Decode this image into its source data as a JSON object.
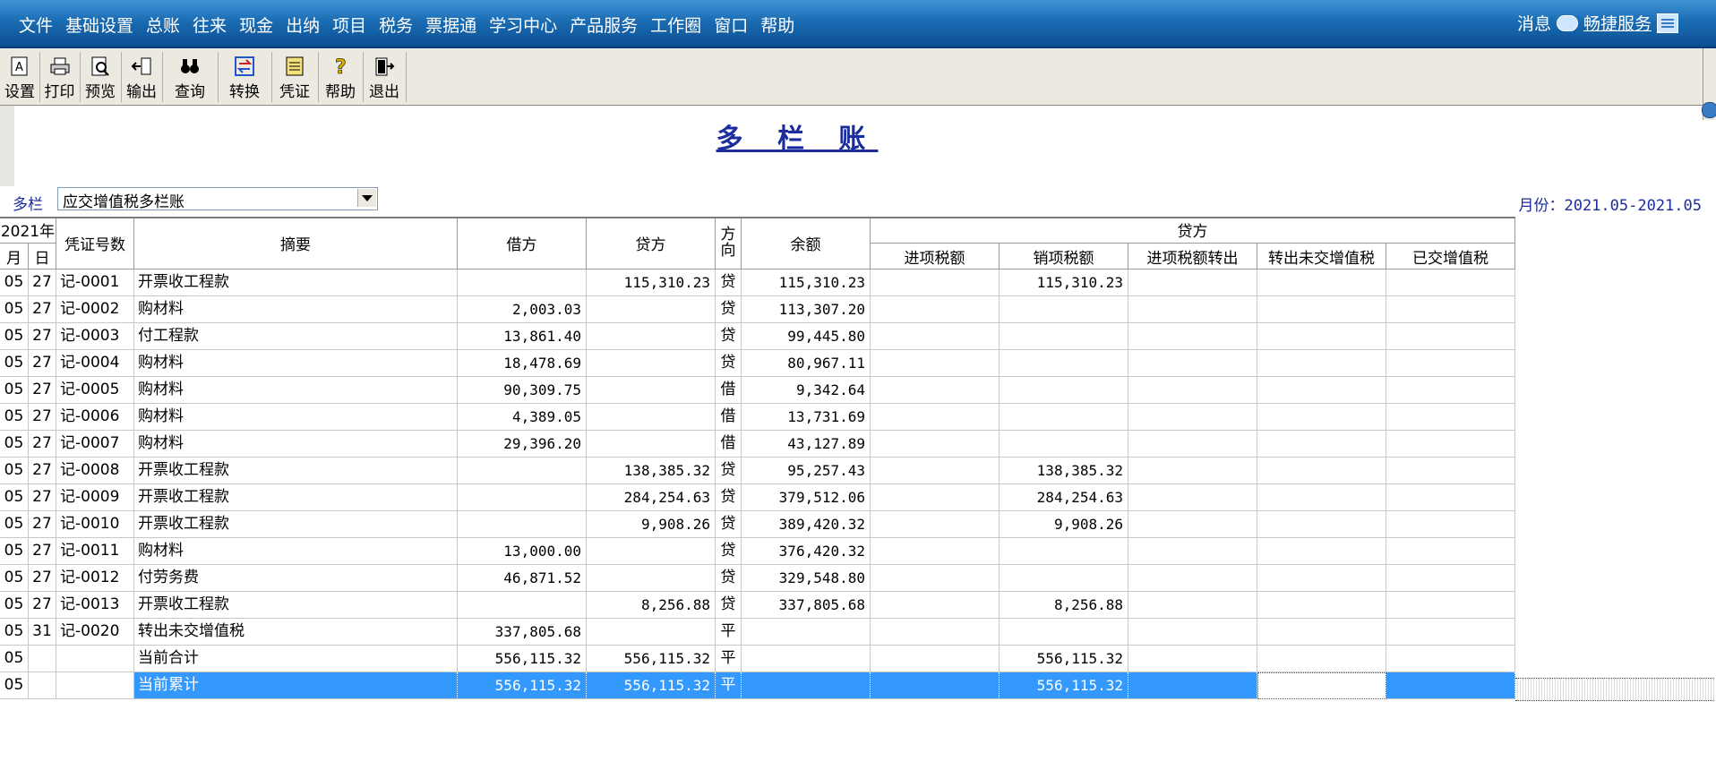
{
  "menu": {
    "items": [
      "文件",
      "基础设置",
      "总账",
      "往来",
      "现金",
      "出纳",
      "项目",
      "税务",
      "票据通",
      "学习中心",
      "产品服务",
      "工作圈",
      "窗口",
      "帮助"
    ],
    "message_label": "消息",
    "service_label": "畅捷服务"
  },
  "toolbar": {
    "buttons": [
      {
        "label": "设置",
        "icon": "settings-icon"
      },
      {
        "label": "打印",
        "icon": "printer-icon"
      },
      {
        "label": "预览",
        "icon": "preview-icon"
      },
      {
        "label": "输出",
        "icon": "export-icon"
      },
      {
        "label": "查询",
        "icon": "binoculars-icon"
      },
      {
        "label": "转换",
        "icon": "convert-icon"
      },
      {
        "label": "凭证",
        "icon": "voucher-icon"
      },
      {
        "label": "帮助",
        "icon": "help-icon"
      },
      {
        "label": "退出",
        "icon": "exit-icon"
      }
    ]
  },
  "report": {
    "title": "多 栏 账",
    "selector_label": "多栏",
    "selector_value": "应交增值税多栏账",
    "month_range": "月份：2021.05-2021.05"
  },
  "table": {
    "year_header": "2021年",
    "month_header": "月",
    "day_header": "日",
    "headers": {
      "voucher": "凭证号数",
      "summary": "摘要",
      "debit": "借方",
      "credit": "贷方",
      "direction": "方向",
      "balance": "余额",
      "credit_group": "贷方",
      "sub": [
        "进项税额",
        "销项税额",
        "进项税额转出",
        "转出未交增值税",
        "已交增值税"
      ]
    },
    "rows": [
      {
        "m": "05",
        "d": "27",
        "v": "记-0001",
        "s": "开票收工程款",
        "debit": "",
        "credit": "115,310.23",
        "dir": "贷",
        "bal": "115,310.23",
        "c1": "",
        "c2": "115,310.23",
        "c3": "",
        "c4": "",
        "c5": ""
      },
      {
        "m": "05",
        "d": "27",
        "v": "记-0002",
        "s": "购材料",
        "debit": "2,003.03",
        "credit": "",
        "dir": "贷",
        "bal": "113,307.20",
        "c1": "",
        "c2": "",
        "c3": "",
        "c4": "",
        "c5": ""
      },
      {
        "m": "05",
        "d": "27",
        "v": "记-0003",
        "s": "付工程款",
        "debit": "13,861.40",
        "credit": "",
        "dir": "贷",
        "bal": "99,445.80",
        "c1": "",
        "c2": "",
        "c3": "",
        "c4": "",
        "c5": ""
      },
      {
        "m": "05",
        "d": "27",
        "v": "记-0004",
        "s": "购材料",
        "debit": "18,478.69",
        "credit": "",
        "dir": "贷",
        "bal": "80,967.11",
        "c1": "",
        "c2": "",
        "c3": "",
        "c4": "",
        "c5": ""
      },
      {
        "m": "05",
        "d": "27",
        "v": "记-0005",
        "s": "购材料",
        "debit": "90,309.75",
        "credit": "",
        "dir": "借",
        "bal": "9,342.64",
        "c1": "",
        "c2": "",
        "c3": "",
        "c4": "",
        "c5": ""
      },
      {
        "m": "05",
        "d": "27",
        "v": "记-0006",
        "s": "购材料",
        "debit": "4,389.05",
        "credit": "",
        "dir": "借",
        "bal": "13,731.69",
        "c1": "",
        "c2": "",
        "c3": "",
        "c4": "",
        "c5": ""
      },
      {
        "m": "05",
        "d": "27",
        "v": "记-0007",
        "s": "购材料",
        "debit": "29,396.20",
        "credit": "",
        "dir": "借",
        "bal": "43,127.89",
        "c1": "",
        "c2": "",
        "c3": "",
        "c4": "",
        "c5": ""
      },
      {
        "m": "05",
        "d": "27",
        "v": "记-0008",
        "s": "开票收工程款",
        "debit": "",
        "credit": "138,385.32",
        "dir": "贷",
        "bal": "95,257.43",
        "c1": "",
        "c2": "138,385.32",
        "c3": "",
        "c4": "",
        "c5": ""
      },
      {
        "m": "05",
        "d": "27",
        "v": "记-0009",
        "s": "开票收工程款",
        "debit": "",
        "credit": "284,254.63",
        "dir": "贷",
        "bal": "379,512.06",
        "c1": "",
        "c2": "284,254.63",
        "c3": "",
        "c4": "",
        "c5": ""
      },
      {
        "m": "05",
        "d": "27",
        "v": "记-0010",
        "s": "开票收工程款",
        "debit": "",
        "credit": "9,908.26",
        "dir": "贷",
        "bal": "389,420.32",
        "c1": "",
        "c2": "9,908.26",
        "c3": "",
        "c4": "",
        "c5": ""
      },
      {
        "m": "05",
        "d": "27",
        "v": "记-0011",
        "s": "购材料",
        "debit": "13,000.00",
        "credit": "",
        "dir": "贷",
        "bal": "376,420.32",
        "c1": "",
        "c2": "",
        "c3": "",
        "c4": "",
        "c5": ""
      },
      {
        "m": "05",
        "d": "27",
        "v": "记-0012",
        "s": "付劳务费",
        "debit": "46,871.52",
        "credit": "",
        "dir": "贷",
        "bal": "329,548.80",
        "c1": "",
        "c2": "",
        "c3": "",
        "c4": "",
        "c5": ""
      },
      {
        "m": "05",
        "d": "27",
        "v": "记-0013",
        "s": "开票收工程款",
        "debit": "",
        "credit": "8,256.88",
        "dir": "贷",
        "bal": "337,805.68",
        "c1": "",
        "c2": "8,256.88",
        "c3": "",
        "c4": "",
        "c5": ""
      },
      {
        "m": "05",
        "d": "31",
        "v": "记-0020",
        "s": "转出未交增值税",
        "debit": "337,805.68",
        "credit": "",
        "dir": "平",
        "bal": "",
        "c1": "",
        "c2": "",
        "c3": "",
        "c4": "",
        "c5": ""
      },
      {
        "m": "05",
        "d": "",
        "v": "",
        "s": "当前合计",
        "debit": "556,115.32",
        "credit": "556,115.32",
        "dir": "平",
        "bal": "",
        "c1": "",
        "c2": "556,115.32",
        "c3": "",
        "c4": "",
        "c5": ""
      },
      {
        "m": "05",
        "d": "",
        "v": "",
        "s": "当前累计",
        "debit": "556,115.32",
        "credit": "556,115.32",
        "dir": "平",
        "bal": "",
        "c1": "",
        "c2": "556,115.32",
        "c3": "",
        "c4": "",
        "c5": "",
        "selected": true
      }
    ]
  },
  "colors": {
    "accent": "#1b2c9c",
    "selection": "#3399ff",
    "menubar": "#1a6cb3"
  }
}
